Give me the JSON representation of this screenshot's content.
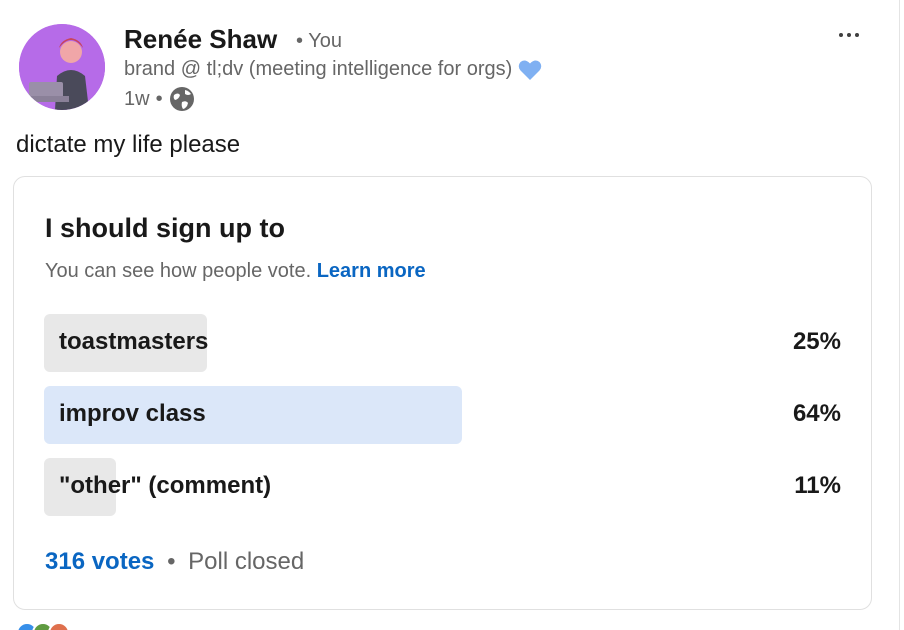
{
  "post": {
    "author_name": "Renée Shaw",
    "separator": "•",
    "you_label": "You",
    "headline": "brand @ tl;dv (meeting intelligence for orgs)",
    "time_ago": "1w",
    "text": "dictate my life please"
  },
  "icons": {
    "heart": "blue-heart-icon",
    "globe": "globe-icon",
    "more": "more-options-icon"
  },
  "poll": {
    "question": "I should sign up to",
    "note": "You can see how people vote.",
    "learn_more": "Learn more",
    "options": [
      {
        "label": "toastmasters",
        "percent_text": "25%",
        "percent": 25
      },
      {
        "label": "improv class",
        "percent_text": "64%",
        "percent": 64
      },
      {
        "label": "\"other\" (comment)",
        "percent_text": "11%",
        "percent": 11
      }
    ],
    "votes": "316 votes",
    "separator": "•",
    "status": "Poll closed"
  },
  "colors": {
    "link": "#0a66c2",
    "bar_default": "#e8e8e8",
    "bar_selected": "#dbe7f9",
    "heart": "#7fb0f2"
  }
}
